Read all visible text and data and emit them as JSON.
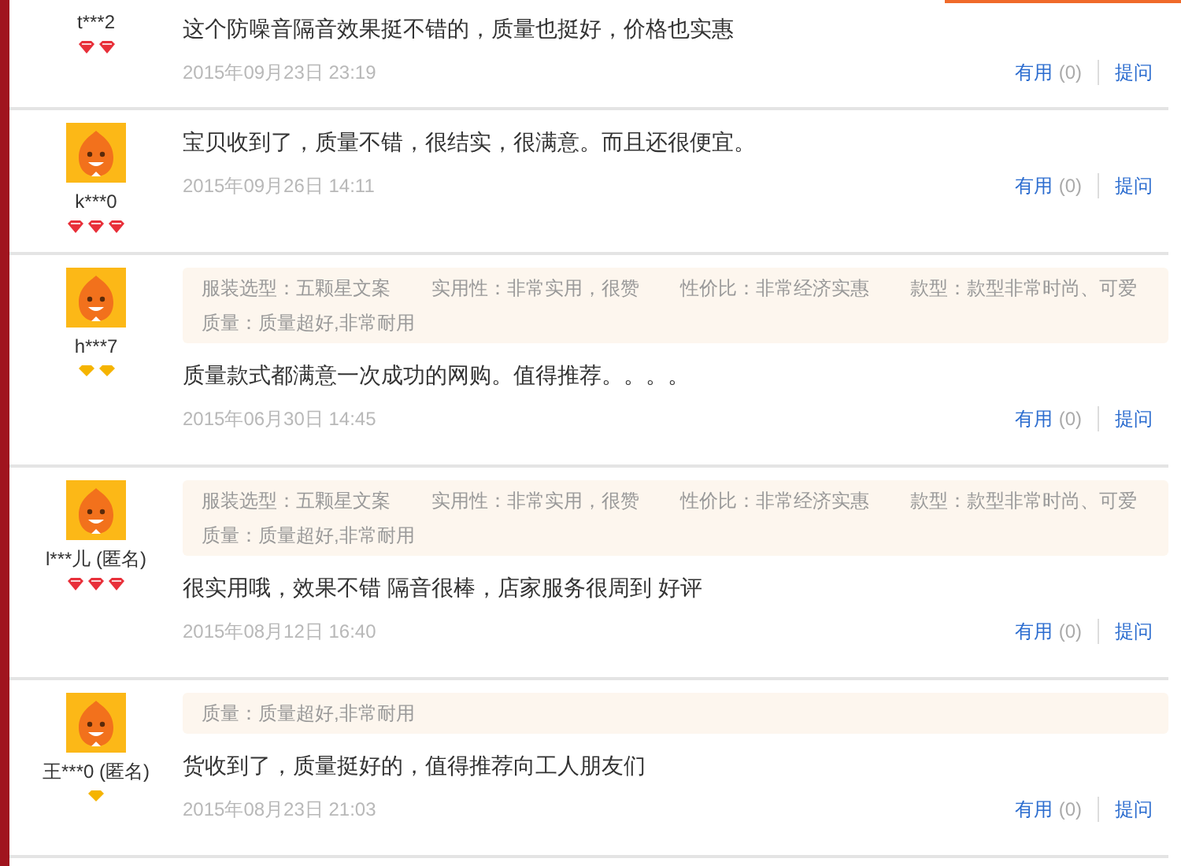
{
  "reviews": [
    {
      "user": "t***2",
      "avatar_visible": false,
      "gems": [
        {
          "kind": "red"
        },
        {
          "kind": "red"
        }
      ],
      "comment": "这个防噪音隔音效果挺不错的，质量也挺好，价格也实惠",
      "date": "2015年09月23日 23:19",
      "useful": "有用",
      "useful_count": "(0)",
      "ask": "提问"
    },
    {
      "user": "k***0",
      "avatar_visible": true,
      "gems": [
        {
          "kind": "red"
        },
        {
          "kind": "red"
        },
        {
          "kind": "red"
        }
      ],
      "comment": "宝贝收到了，质量不错，很结实，很满意。而且还很便宜。",
      "date": "2015年09月26日 14:11",
      "useful": "有用",
      "useful_count": "(0)",
      "ask": "提问"
    },
    {
      "user": "h***7",
      "avatar_visible": true,
      "gems": [
        {
          "kind": "gold"
        },
        {
          "kind": "gold"
        }
      ],
      "tags": [
        "服装选型：五颗星文案",
        "实用性：非常实用，很赞",
        "性价比：非常经济实惠",
        "款型：款型非常时尚、可爱",
        "质量：质量超好,非常耐用"
      ],
      "comment": "质量款式都满意一次成功的网购。值得推荐。。。。",
      "date": "2015年06月30日 14:45",
      "useful": "有用",
      "useful_count": "(0)",
      "ask": "提问"
    },
    {
      "user": "l***儿 (匿名)",
      "avatar_visible": true,
      "gems": [
        {
          "kind": "red"
        },
        {
          "kind": "red"
        },
        {
          "kind": "red"
        }
      ],
      "tags": [
        "服装选型：五颗星文案",
        "实用性：非常实用，很赞",
        "性价比：非常经济实惠",
        "款型：款型非常时尚、可爱",
        "质量：质量超好,非常耐用"
      ],
      "comment": "很实用哦，效果不错 隔音很棒，店家服务很周到 好评",
      "date": "2015年08月12日 16:40",
      "useful": "有用",
      "useful_count": "(0)",
      "ask": "提问"
    },
    {
      "user": "王***0 (匿名)",
      "avatar_visible": true,
      "gems": [
        {
          "kind": "gold"
        }
      ],
      "tags": [
        "质量：质量超好,非常耐用"
      ],
      "comment": "货收到了，质量挺好的，值得推荐向工人朋友们",
      "date": "2015年08月23日 21:03",
      "useful": "有用",
      "useful_count": "(0)",
      "ask": "提问"
    }
  ]
}
